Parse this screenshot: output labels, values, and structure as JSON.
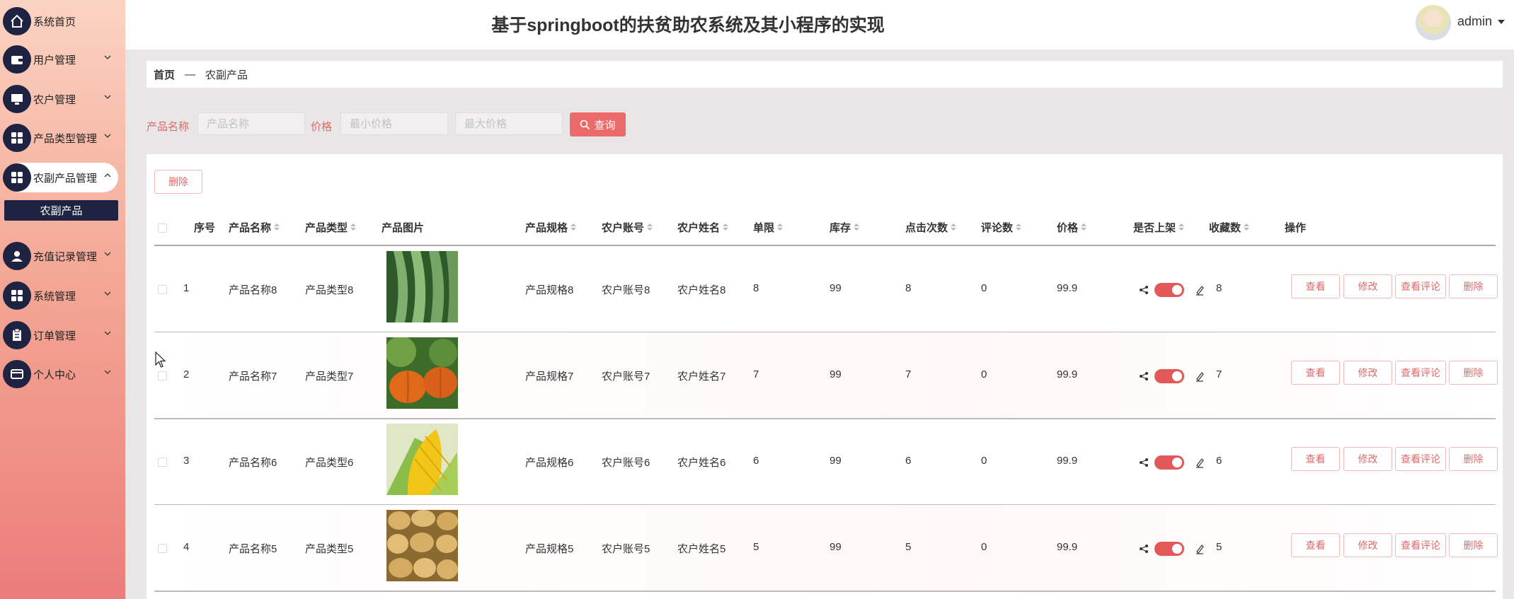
{
  "sidebar": {
    "items": [
      {
        "label": "系统首页",
        "icon": "home-icon"
      },
      {
        "label": "用户管理",
        "icon": "wallet-icon"
      },
      {
        "label": "农户管理",
        "icon": "monitor-icon"
      },
      {
        "label": "产品类型管理",
        "icon": "grid-icon"
      },
      {
        "label": "农副产品管理",
        "icon": "grid-icon"
      },
      {
        "label": "充值记录管理",
        "icon": "user-icon"
      },
      {
        "label": "系统管理",
        "icon": "grid-icon"
      },
      {
        "label": "订单管理",
        "icon": "clipboard-icon"
      },
      {
        "label": "个人中心",
        "icon": "card-icon"
      }
    ],
    "submenu_label": "农副产品"
  },
  "header": {
    "title": "基于springboot的扶贫助农系统及其小程序的实现",
    "username": "admin"
  },
  "breadcrumb": {
    "home": "首页",
    "separator": "—",
    "current": "农副产品"
  },
  "search": {
    "name_label": "产品名称",
    "name_placeholder": "产品名称",
    "price_label": "价格",
    "min_placeholder": "最小价格",
    "max_placeholder": "最大价格",
    "query_label": "查询"
  },
  "toolbar": {
    "delete_label": "删除"
  },
  "table": {
    "headers": [
      "序号",
      "产品名称",
      "产品类型",
      "产品图片",
      "产品规格",
      "农户账号",
      "农户姓名",
      "单限",
      "库存",
      "点击次数",
      "评论数",
      "价格",
      "是否上架",
      "收藏数",
      "操作"
    ],
    "rows": [
      {
        "index": "1",
        "name": "产品名称8",
        "type": "产品类型8",
        "image": "luffa",
        "spec": "产品规格8",
        "account": "农户账号8",
        "farmer": "农户姓名8",
        "limit": "8",
        "stock": "99",
        "clicks": "8",
        "comments": "0",
        "price": "99.9",
        "on_sale": true,
        "favorites": "8"
      },
      {
        "index": "2",
        "name": "产品名称7",
        "type": "产品类型7",
        "image": "pumpkin",
        "spec": "产品规格7",
        "account": "农户账号7",
        "farmer": "农户姓名7",
        "limit": "7",
        "stock": "99",
        "clicks": "7",
        "comments": "0",
        "price": "99.9",
        "on_sale": true,
        "favorites": "7"
      },
      {
        "index": "3",
        "name": "产品名称6",
        "type": "产品类型6",
        "image": "corn",
        "spec": "产品规格6",
        "account": "农户账号6",
        "farmer": "农户姓名6",
        "limit": "6",
        "stock": "99",
        "clicks": "6",
        "comments": "0",
        "price": "99.9",
        "on_sale": true,
        "favorites": "6"
      },
      {
        "index": "4",
        "name": "产品名称5",
        "type": "产品类型5",
        "image": "potato",
        "spec": "产品规格5",
        "account": "农户账号5",
        "farmer": "农户姓名5",
        "limit": "5",
        "stock": "99",
        "clicks": "5",
        "comments": "0",
        "price": "99.9",
        "on_sale": true,
        "favorites": "5"
      }
    ],
    "actions": [
      "查看",
      "修改",
      "查看评论",
      "删除"
    ]
  },
  "colors": {
    "accent": "#eb6a6a",
    "sidebar_dark": "#1d2340",
    "switch_on": "#e25757"
  }
}
